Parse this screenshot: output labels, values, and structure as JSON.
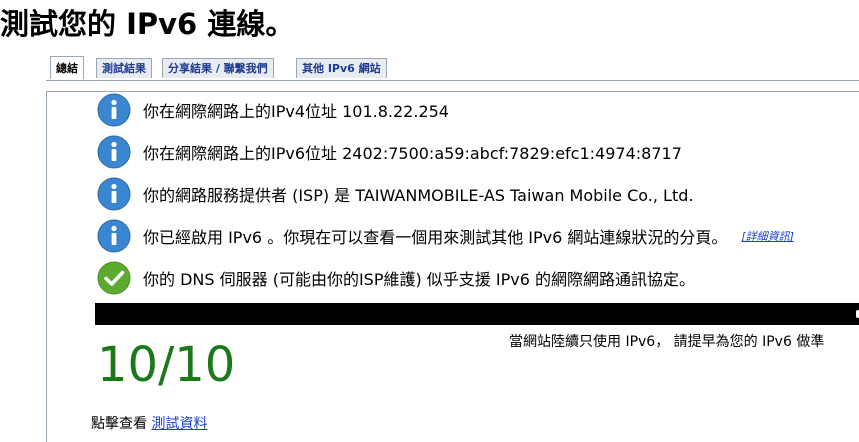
{
  "title": "測試您的 IPv6 連線。",
  "tabs": [
    {
      "label": "總結",
      "active": true
    },
    {
      "label": "測試結果",
      "active": false
    },
    {
      "label": "分享結果 / 聯繫我們",
      "active": false
    },
    {
      "label": "其他 IPv6 網站",
      "active": false
    }
  ],
  "results": [
    {
      "icon": "info-icon",
      "text": "你在網際網路上的IPv4位址 101.8.22.254"
    },
    {
      "icon": "info-icon",
      "text": "你在網際網路上的IPv6位址 2402:7500:a59:abcf:7829:efc1:4974:8717"
    },
    {
      "icon": "info-icon",
      "text": "你的網路服務提供者 (ISP) 是 TAIWANMOBILE-AS Taiwan Mobile Co., Ltd."
    },
    {
      "icon": "info-icon",
      "text": "你已經啟用 IPv6 。你現在可以查看一個用來測試其他 IPv6 網站連線狀況的分頁。",
      "link": "[詳細資訊]"
    },
    {
      "icon": "check-icon",
      "text": "你的 DNS 伺服器 (可能由你的ISP維護) 似乎支援 IPv6 的網際網路通訊協定。"
    }
  ],
  "note": "當網站陸續只使用 IPv6， 請提早為您的 IPv6 做準",
  "score": "10/10",
  "footer": {
    "prefix": "點擊查看",
    "link": "測試資料"
  },
  "colors": {
    "info": "#3a86d0",
    "check": "#5cab2e",
    "score": "#1a7a1a",
    "link": "#1a3fc8"
  }
}
